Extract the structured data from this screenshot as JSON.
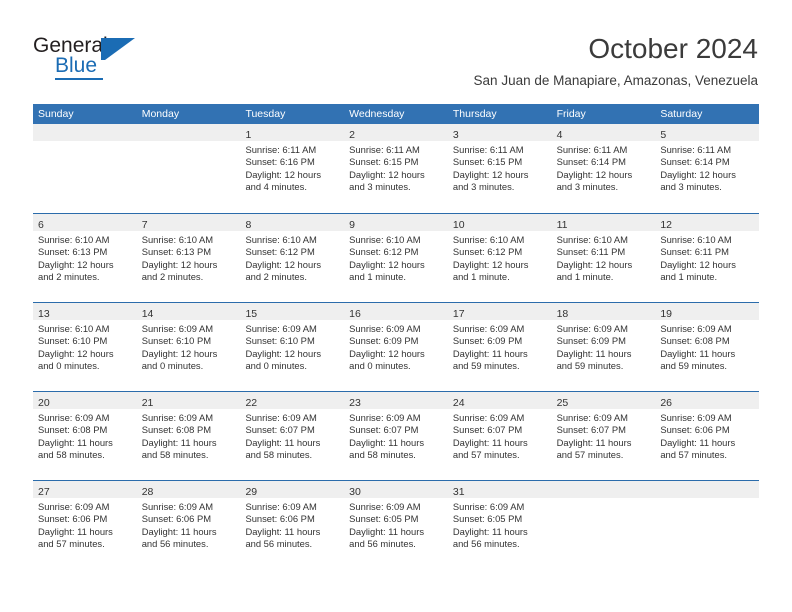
{
  "branding": {
    "name_part1": "General",
    "name_part2": "Blue"
  },
  "header": {
    "month_title": "October 2024",
    "location": "San Juan de Manapiare, Amazonas, Venezuela"
  },
  "colors": {
    "header_blue": "#3272b3",
    "row_divider_blue": "#2b6cab",
    "day_band_gray": "#efefef",
    "logo_blue": "#1b6cb4",
    "text": "#333333"
  },
  "calendar": {
    "weekdays": [
      "Sunday",
      "Monday",
      "Tuesday",
      "Wednesday",
      "Thursday",
      "Friday",
      "Saturday"
    ],
    "weeks": [
      [
        {
          "day": "",
          "sunrise": "",
          "sunset": "",
          "daylight": "",
          "daylight2": ""
        },
        {
          "day": "",
          "sunrise": "",
          "sunset": "",
          "daylight": "",
          "daylight2": ""
        },
        {
          "day": "1",
          "sunrise": "Sunrise: 6:11 AM",
          "sunset": "Sunset: 6:16 PM",
          "daylight": "Daylight: 12 hours",
          "daylight2": "and 4 minutes."
        },
        {
          "day": "2",
          "sunrise": "Sunrise: 6:11 AM",
          "sunset": "Sunset: 6:15 PM",
          "daylight": "Daylight: 12 hours",
          "daylight2": "and 3 minutes."
        },
        {
          "day": "3",
          "sunrise": "Sunrise: 6:11 AM",
          "sunset": "Sunset: 6:15 PM",
          "daylight": "Daylight: 12 hours",
          "daylight2": "and 3 minutes."
        },
        {
          "day": "4",
          "sunrise": "Sunrise: 6:11 AM",
          "sunset": "Sunset: 6:14 PM",
          "daylight": "Daylight: 12 hours",
          "daylight2": "and 3 minutes."
        },
        {
          "day": "5",
          "sunrise": "Sunrise: 6:11 AM",
          "sunset": "Sunset: 6:14 PM",
          "daylight": "Daylight: 12 hours",
          "daylight2": "and 3 minutes."
        }
      ],
      [
        {
          "day": "6",
          "sunrise": "Sunrise: 6:10 AM",
          "sunset": "Sunset: 6:13 PM",
          "daylight": "Daylight: 12 hours",
          "daylight2": "and 2 minutes."
        },
        {
          "day": "7",
          "sunrise": "Sunrise: 6:10 AM",
          "sunset": "Sunset: 6:13 PM",
          "daylight": "Daylight: 12 hours",
          "daylight2": "and 2 minutes."
        },
        {
          "day": "8",
          "sunrise": "Sunrise: 6:10 AM",
          "sunset": "Sunset: 6:12 PM",
          "daylight": "Daylight: 12 hours",
          "daylight2": "and 2 minutes."
        },
        {
          "day": "9",
          "sunrise": "Sunrise: 6:10 AM",
          "sunset": "Sunset: 6:12 PM",
          "daylight": "Daylight: 12 hours",
          "daylight2": "and 1 minute."
        },
        {
          "day": "10",
          "sunrise": "Sunrise: 6:10 AM",
          "sunset": "Sunset: 6:12 PM",
          "daylight": "Daylight: 12 hours",
          "daylight2": "and 1 minute."
        },
        {
          "day": "11",
          "sunrise": "Sunrise: 6:10 AM",
          "sunset": "Sunset: 6:11 PM",
          "daylight": "Daylight: 12 hours",
          "daylight2": "and 1 minute."
        },
        {
          "day": "12",
          "sunrise": "Sunrise: 6:10 AM",
          "sunset": "Sunset: 6:11 PM",
          "daylight": "Daylight: 12 hours",
          "daylight2": "and 1 minute."
        }
      ],
      [
        {
          "day": "13",
          "sunrise": "Sunrise: 6:10 AM",
          "sunset": "Sunset: 6:10 PM",
          "daylight": "Daylight: 12 hours",
          "daylight2": "and 0 minutes."
        },
        {
          "day": "14",
          "sunrise": "Sunrise: 6:09 AM",
          "sunset": "Sunset: 6:10 PM",
          "daylight": "Daylight: 12 hours",
          "daylight2": "and 0 minutes."
        },
        {
          "day": "15",
          "sunrise": "Sunrise: 6:09 AM",
          "sunset": "Sunset: 6:10 PM",
          "daylight": "Daylight: 12 hours",
          "daylight2": "and 0 minutes."
        },
        {
          "day": "16",
          "sunrise": "Sunrise: 6:09 AM",
          "sunset": "Sunset: 6:09 PM",
          "daylight": "Daylight: 12 hours",
          "daylight2": "and 0 minutes."
        },
        {
          "day": "17",
          "sunrise": "Sunrise: 6:09 AM",
          "sunset": "Sunset: 6:09 PM",
          "daylight": "Daylight: 11 hours",
          "daylight2": "and 59 minutes."
        },
        {
          "day": "18",
          "sunrise": "Sunrise: 6:09 AM",
          "sunset": "Sunset: 6:09 PM",
          "daylight": "Daylight: 11 hours",
          "daylight2": "and 59 minutes."
        },
        {
          "day": "19",
          "sunrise": "Sunrise: 6:09 AM",
          "sunset": "Sunset: 6:08 PM",
          "daylight": "Daylight: 11 hours",
          "daylight2": "and 59 minutes."
        }
      ],
      [
        {
          "day": "20",
          "sunrise": "Sunrise: 6:09 AM",
          "sunset": "Sunset: 6:08 PM",
          "daylight": "Daylight: 11 hours",
          "daylight2": "and 58 minutes."
        },
        {
          "day": "21",
          "sunrise": "Sunrise: 6:09 AM",
          "sunset": "Sunset: 6:08 PM",
          "daylight": "Daylight: 11 hours",
          "daylight2": "and 58 minutes."
        },
        {
          "day": "22",
          "sunrise": "Sunrise: 6:09 AM",
          "sunset": "Sunset: 6:07 PM",
          "daylight": "Daylight: 11 hours",
          "daylight2": "and 58 minutes."
        },
        {
          "day": "23",
          "sunrise": "Sunrise: 6:09 AM",
          "sunset": "Sunset: 6:07 PM",
          "daylight": "Daylight: 11 hours",
          "daylight2": "and 58 minutes."
        },
        {
          "day": "24",
          "sunrise": "Sunrise: 6:09 AM",
          "sunset": "Sunset: 6:07 PM",
          "daylight": "Daylight: 11 hours",
          "daylight2": "and 57 minutes."
        },
        {
          "day": "25",
          "sunrise": "Sunrise: 6:09 AM",
          "sunset": "Sunset: 6:07 PM",
          "daylight": "Daylight: 11 hours",
          "daylight2": "and 57 minutes."
        },
        {
          "day": "26",
          "sunrise": "Sunrise: 6:09 AM",
          "sunset": "Sunset: 6:06 PM",
          "daylight": "Daylight: 11 hours",
          "daylight2": "and 57 minutes."
        }
      ],
      [
        {
          "day": "27",
          "sunrise": "Sunrise: 6:09 AM",
          "sunset": "Sunset: 6:06 PM",
          "daylight": "Daylight: 11 hours",
          "daylight2": "and 57 minutes."
        },
        {
          "day": "28",
          "sunrise": "Sunrise: 6:09 AM",
          "sunset": "Sunset: 6:06 PM",
          "daylight": "Daylight: 11 hours",
          "daylight2": "and 56 minutes."
        },
        {
          "day": "29",
          "sunrise": "Sunrise: 6:09 AM",
          "sunset": "Sunset: 6:06 PM",
          "daylight": "Daylight: 11 hours",
          "daylight2": "and 56 minutes."
        },
        {
          "day": "30",
          "sunrise": "Sunrise: 6:09 AM",
          "sunset": "Sunset: 6:05 PM",
          "daylight": "Daylight: 11 hours",
          "daylight2": "and 56 minutes."
        },
        {
          "day": "31",
          "sunrise": "Sunrise: 6:09 AM",
          "sunset": "Sunset: 6:05 PM",
          "daylight": "Daylight: 11 hours",
          "daylight2": "and 56 minutes."
        },
        {
          "day": "",
          "sunrise": "",
          "sunset": "",
          "daylight": "",
          "daylight2": ""
        },
        {
          "day": "",
          "sunrise": "",
          "sunset": "",
          "daylight": "",
          "daylight2": ""
        }
      ]
    ]
  }
}
